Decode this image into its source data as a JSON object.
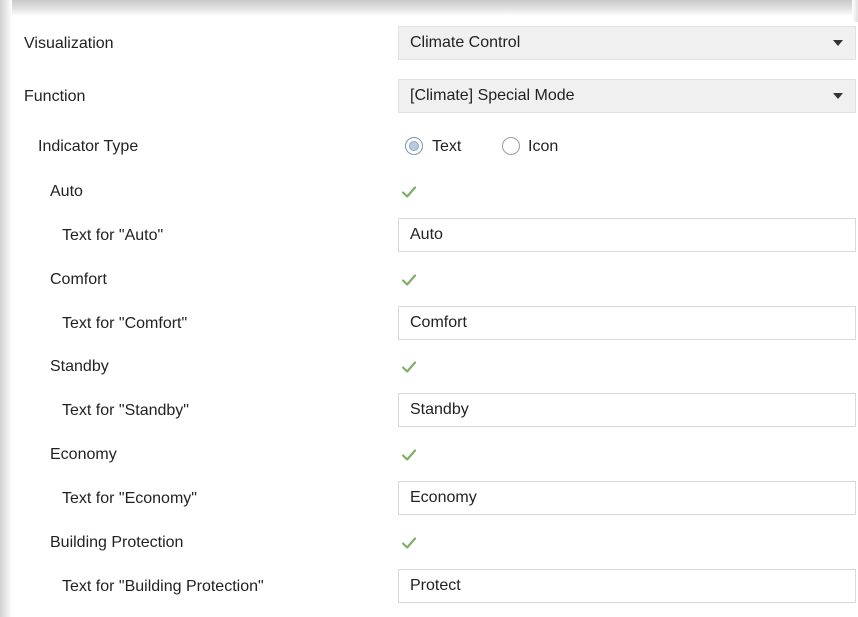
{
  "visualization": {
    "label": "Visualization",
    "value": "Climate Control"
  },
  "function": {
    "label": "Function",
    "value": "[Climate] Special Mode"
  },
  "indicator_type": {
    "label": "Indicator Type",
    "options": [
      {
        "label": "Text",
        "checked": true
      },
      {
        "label": "Icon",
        "checked": false
      }
    ]
  },
  "modes": [
    {
      "label": "Auto",
      "enabled": true,
      "text_label": "Text for \"Auto\"",
      "text_value": "Auto"
    },
    {
      "label": "Comfort",
      "enabled": true,
      "text_label": "Text for \"Comfort\"",
      "text_value": "Comfort"
    },
    {
      "label": "Standby",
      "enabled": true,
      "text_label": "Text for \"Standby\"",
      "text_value": "Standby"
    },
    {
      "label": "Economy",
      "enabled": true,
      "text_label": "Text for \"Economy\"",
      "text_value": "Economy"
    },
    {
      "label": "Building Protection",
      "enabled": true,
      "text_label": "Text for \"Building Protection\"",
      "text_value": "Protect"
    }
  ],
  "colors": {
    "check": "#7cb068",
    "select_bg": "#f0f0f0",
    "radio_accent": "#8aa4c4"
  }
}
